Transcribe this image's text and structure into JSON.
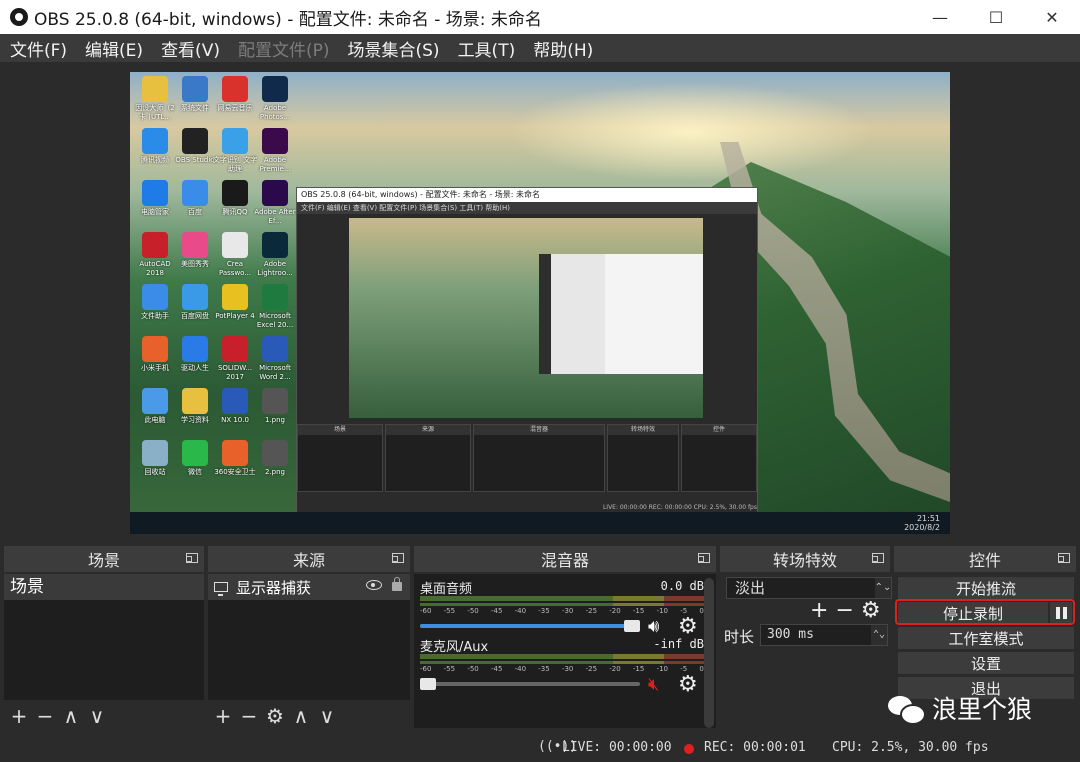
{
  "window": {
    "title": "OBS 25.0.8 (64-bit, windows) - 配置文件: 未命名 - 场景: 未命名",
    "minimize": "—",
    "maximize": "☐",
    "close": "✕"
  },
  "menu": [
    "文件(F)",
    "编辑(E)",
    "查看(V)",
    "配置文件(P)",
    "场景集合(S)",
    "工具(T)",
    "帮助(H)"
  ],
  "preview": {
    "desktop_icons": [
      {
        "label": "因设大师（2 卡 (UTL...",
        "color": "#e8c040"
      },
      {
        "label": "系统文件",
        "color": "#3a78c8"
      },
      {
        "label": "网易云音乐",
        "color": "#d9322c"
      },
      {
        "label": "Adobe Photos...",
        "color": "#0f2a4a"
      },
      {
        "label": "腾讯视频",
        "color": "#2a8ce8"
      },
      {
        "label": "OBS Studio",
        "color": "#222222"
      },
      {
        "label": "文字识别 文字助理",
        "color": "#3aa0e8"
      },
      {
        "label": "Adobe Premie...",
        "color": "#3a0a4a"
      },
      {
        "label": "电脑管家",
        "color": "#1e7be8"
      },
      {
        "label": "百度",
        "color": "#3a8ce8"
      },
      {
        "label": "腾讯QQ",
        "color": "#1a1a1a"
      },
      {
        "label": "Adobe After Ef...",
        "color": "#2a0a4a"
      },
      {
        "label": "AutoCAD 2018",
        "color": "#c8202a"
      },
      {
        "label": "美图秀秀",
        "color": "#e84a8a"
      },
      {
        "label": "Crea Passwo...",
        "color": "#e8e8e8"
      },
      {
        "label": "Adobe Lightroo...",
        "color": "#0a2a3a"
      },
      {
        "label": "文件助手",
        "color": "#3a8ce8"
      },
      {
        "label": "百度网盘",
        "color": "#3a9ae8"
      },
      {
        "label": "PotPlayer 4",
        "color": "#e8c020"
      },
      {
        "label": "Microsoft Excel 20...",
        "color": "#1e7a3e"
      },
      {
        "label": "小米手机",
        "color": "#e8602a"
      },
      {
        "label": "驱动人生",
        "color": "#2a7ae8"
      },
      {
        "label": "SOLIDW... 2017",
        "color": "#c8202a"
      },
      {
        "label": "Microsoft Word 2...",
        "color": "#2a5ab8"
      },
      {
        "label": "此电脑",
        "color": "#4a9ae8"
      },
      {
        "label": "学习资料",
        "color": "#e8c040"
      },
      {
        "label": "NX 10.0",
        "color": "#2a5ab8"
      },
      {
        "label": "1.png",
        "color": "#555555"
      },
      {
        "label": "回收站",
        "color": "#8ab0c8"
      },
      {
        "label": "微信",
        "color": "#2ab84a"
      },
      {
        "label": "360安全卫士",
        "color": "#e8602a"
      },
      {
        "label": "2.png",
        "color": "#555555"
      }
    ],
    "taskbar_time": "21:51",
    "taskbar_date": "2020/8/2",
    "nested_title": "OBS 25.0.8 (64-bit, windows) - 配置文件: 未命名 - 场景: 未命名",
    "nested_menu": "文件(F)  编辑(E)  查看(V)  配置文件(P)  场景集合(S)  工具(T)  帮助(H)",
    "nested_docks": [
      "场景",
      "来源",
      "混音器",
      "转场特效",
      "控件"
    ],
    "nested_status": "LIVE: 00:00:00  REC: 00:00:00  CPU: 2.5%, 30.00 fps"
  },
  "docks": {
    "scenes": {
      "title": "场景",
      "items": [
        "场景"
      ]
    },
    "sources": {
      "title": "来源",
      "items": [
        "显示器捕获"
      ]
    },
    "mixer": {
      "title": "混音器",
      "ticks": [
        "-60",
        "-55",
        "-50",
        "-45",
        "-40",
        "-35",
        "-30",
        "-25",
        "-20",
        "-15",
        "-10",
        "-5",
        "0"
      ],
      "channels": [
        {
          "name": "桌面音频",
          "db": "0.0 dB",
          "muted": false,
          "volume": 1.0
        },
        {
          "name": "麦克风/Aux",
          "db": "-inf dB",
          "muted": true,
          "volume": 0.0
        }
      ]
    },
    "transitions": {
      "title": "转场特效",
      "selected": "淡出",
      "duration_label": "时长",
      "duration_value": "300 ms"
    },
    "controls": {
      "title": "控件",
      "buttons": [
        "开始推流",
        "停止录制",
        "工作室模式",
        "设置",
        "退出"
      ]
    }
  },
  "statusbar": {
    "live": "LIVE: 00:00:00",
    "rec": "REC: 00:00:01",
    "cpu": "CPU: 2.5%, 30.00 fps"
  },
  "watermark": "浪里个狼",
  "colors": {
    "accent_blue": "#3d8ee0",
    "record_red": "#e02020",
    "highlight_border": "#e02020"
  }
}
